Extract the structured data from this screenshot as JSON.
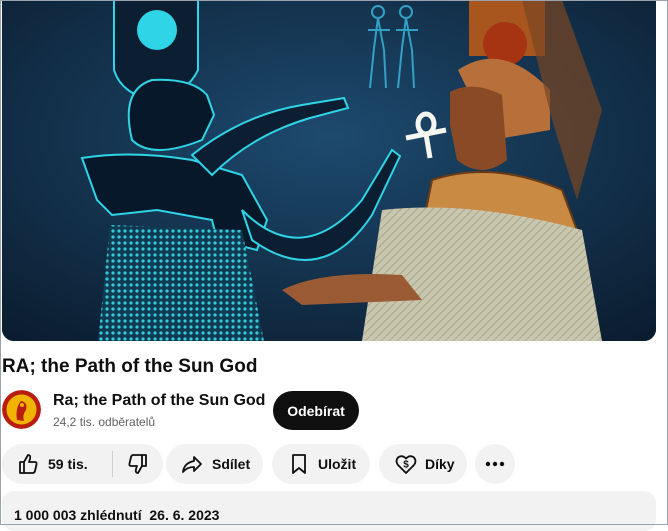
{
  "video": {
    "thumbnail_icon": "egyptian-scene-illustration"
  },
  "title": "RA; the Path of the Sun God",
  "channel": {
    "name": "Ra; the Path of the Sun God",
    "subscribers": "24,2 tis. odběratelů",
    "avatar_icon": "cobra-avatar-icon"
  },
  "subscribe_label": "Odebírat",
  "actions": {
    "likes": "59 tis.",
    "share_label": "Sdílet",
    "save_label": "Uložit",
    "thanks_label": "Díky",
    "icons": {
      "like": "thumbs-up-icon",
      "dislike": "thumbs-down-icon",
      "share": "share-arrow-icon",
      "save": "bookmark-icon",
      "thanks": "dollar-heart-icon",
      "more": "more-horizontal-icon"
    }
  },
  "description": {
    "views": "1 000 003 zhlédnutí",
    "date": "26. 6. 2023"
  },
  "colors": {
    "subscribe_bg": "#0f0f0f",
    "pill_bg": "#f2f2f2",
    "glow": "#2fd4e6"
  }
}
